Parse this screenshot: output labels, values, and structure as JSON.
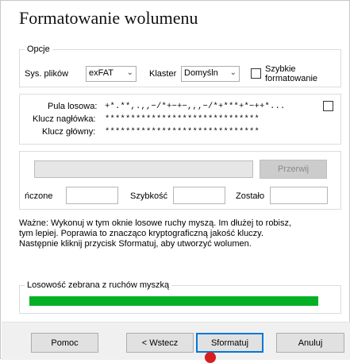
{
  "title": "Formatowanie wolumenu",
  "options": {
    "legend": "Opcje",
    "fs_label": "Sys. plików",
    "fs_value": "exFAT",
    "cluster_label": "Klaster",
    "cluster_value": "Domyśln",
    "quick_format_line1": "Szybkie",
    "quick_format_line2": "formatowanie",
    "quick_format_checked": false
  },
  "keys": {
    "pool_label": "Pula losowa:",
    "pool_value": "+*.**,.,,−/*+−+−,,,−/*+***+*−++*...",
    "header_key_label": "Klucz nagłówka:",
    "header_key_value": "******************************",
    "master_key_label": "Klucz główny:",
    "master_key_value": "******************************",
    "show_checked": false
  },
  "progress": {
    "abort_label": "Przerwij",
    "done_label": "ńczone",
    "speed_label": "Szybkość",
    "left_label": "Zostało",
    "done_value": "",
    "speed_value": "",
    "left_value": ""
  },
  "info": {
    "line1": "Ważne: Wykonuj w tym oknie losowe ruchy myszą. Im dłużej to robisz,",
    "line2": "tym lepiej. Poprawia to znacząco kryptograficzną jakość kluczy.",
    "line3": "Następnie kliknij przycisk Sformatuj, aby utworzyć wolumen."
  },
  "randomness": {
    "legend": "Losowość zebrana z ruchów myszką",
    "level": 1.0,
    "color": "#06b025"
  },
  "buttons": {
    "help": "Pomoc",
    "back": "< Wstecz",
    "format": "Sformatuj",
    "cancel": "Anuluj"
  },
  "colors": {
    "accent": "#0078d7",
    "cursor_dot": "#d81e1e"
  }
}
